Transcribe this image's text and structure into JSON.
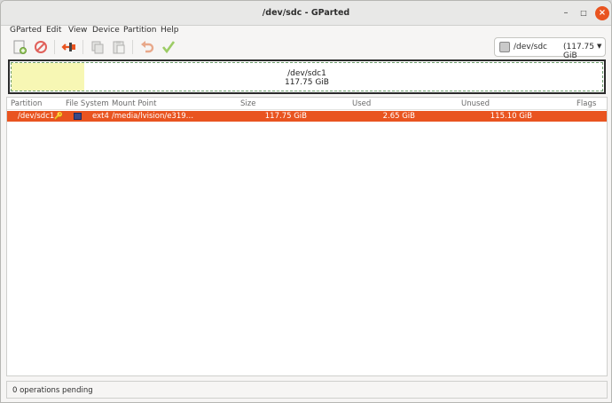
{
  "window": {
    "title": "/dev/sdc - GParted"
  },
  "menubar": {
    "items": [
      "GParted",
      "Edit",
      "View",
      "Device",
      "Partition",
      "Help"
    ]
  },
  "toolbar": {
    "buttons": [
      "new-partition",
      "delete-partition",
      "resize-move",
      "copy",
      "paste",
      "undo",
      "apply"
    ]
  },
  "device_selector": {
    "device": "/dev/sdc",
    "size": "(117.75 GiB"
  },
  "disk_map": {
    "partition_name": "/dev/sdc1",
    "partition_size": "117.75 GiB",
    "used_fraction": 0.022
  },
  "table": {
    "headers": [
      "Partition",
      "File System",
      "Mount Point",
      "Size",
      "Used",
      "Unused",
      "Flags"
    ],
    "rows": [
      {
        "partition": "/dev/sdc1",
        "filesystem": "ext4",
        "mount_point": "/media/lvision/e319…",
        "size": "117.75 GiB",
        "used": "2.65 GiB",
        "unused": "115.10 GiB",
        "flags": ""
      }
    ]
  },
  "status": {
    "text": "0 operations pending"
  },
  "colors": {
    "accent": "#e95420",
    "fs_ext4": "#3a4a86",
    "used_bar": "#f7f7b4"
  }
}
